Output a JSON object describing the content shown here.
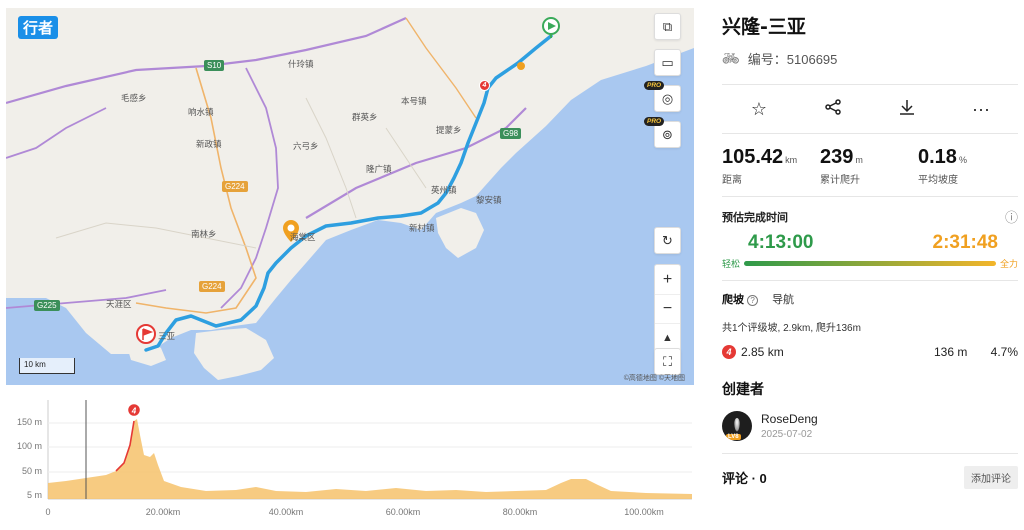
{
  "map": {
    "brand": "行者",
    "places": [
      "什玲镇",
      "毛感乡",
      "响水镇",
      "新政镇",
      "本号镇",
      "群英乡",
      "六弓乡",
      "提蒙乡",
      "隆广镇",
      "英州镇",
      "黎安镇",
      "新村镇",
      "南林乡",
      "海棠区",
      "天涯区",
      "三亚"
    ],
    "roads": [
      "S10",
      "G224",
      "G224",
      "G98",
      "G225"
    ],
    "scale_label": "10 km",
    "attribution": "©高德地图 ©天地图",
    "pro_badge": "PRO",
    "climb_marker": "4",
    "controls": [
      "copy-icon",
      "book-icon",
      "globe-icon",
      "satellite-icon",
      "reset-view-icon",
      "zoom-in-icon",
      "zoom-out-icon",
      "compass-icon",
      "fullscreen-icon"
    ],
    "zoom_in": "+",
    "zoom_out": "−",
    "route_color": "#2e9fe0"
  },
  "elevation": {
    "y_ticks": [
      "150 m",
      "100 m",
      "50 m",
      "5 m"
    ],
    "x_ticks": [
      "0",
      "20.00km",
      "40.00km",
      "60.00km",
      "80.00km",
      "100.00km"
    ],
    "climb_marker": "4",
    "fill_color": "#f6c26b"
  },
  "route": {
    "title": "兴隆-三亚",
    "id_label": "编号：5106695",
    "actions": [
      "star-icon",
      "share-icon",
      "download-icon",
      "more-icon"
    ],
    "stats": [
      {
        "value": "105.42",
        "unit": "km",
        "label": "距离"
      },
      {
        "value": "239",
        "unit": "m",
        "label": "累计爬升"
      },
      {
        "value": "0.18",
        "unit": "%",
        "label": "平均坡度"
      }
    ]
  },
  "estimate": {
    "title": "预估完成时间",
    "easy_time": "4:13:00",
    "full_time": "2:31:48",
    "easy_label": "轻松",
    "full_label": "全力",
    "info_icon": "ⓘ"
  },
  "tabs": {
    "climb": "爬坡",
    "nav": "导航",
    "help_icon": "?"
  },
  "climb": {
    "summary": "共1个评级坡, 2.9km, 爬升136m",
    "badge": "4",
    "distance": "2.85 km",
    "gain": "136 m",
    "grade": "4.7%"
  },
  "creator": {
    "title": "创建者",
    "name": "RoseDeng",
    "date": "2025-07-02",
    "level": "LV8"
  },
  "comments": {
    "title": "评论 · 0",
    "add_label": "添加评论"
  }
}
